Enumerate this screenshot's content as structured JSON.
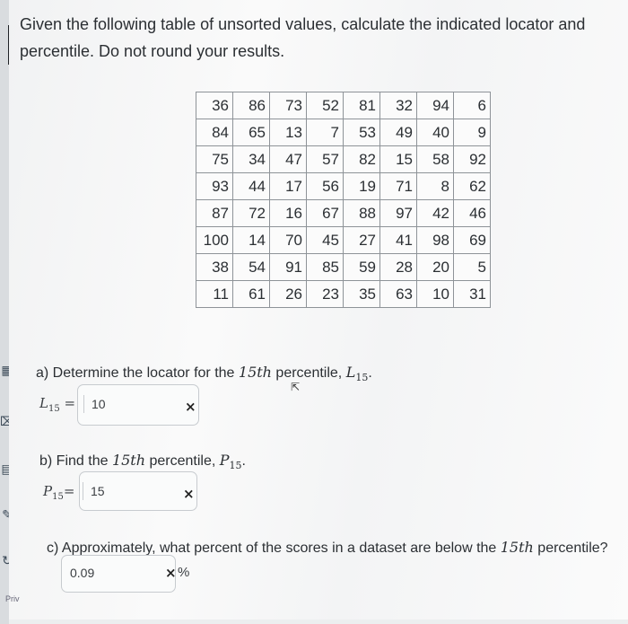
{
  "prompt": {
    "line1": "Given the following table of unsorted values, calculate the indicated locator and",
    "line2": "percentile. Do not round your results."
  },
  "table": {
    "rows": [
      [
        36,
        86,
        73,
        52,
        81,
        32,
        94,
        6
      ],
      [
        84,
        65,
        13,
        7,
        53,
        49,
        40,
        9
      ],
      [
        75,
        34,
        47,
        57,
        82,
        15,
        58,
        92
      ],
      [
        93,
        44,
        17,
        56,
        19,
        71,
        8,
        62
      ],
      [
        87,
        72,
        16,
        67,
        88,
        97,
        42,
        46
      ],
      [
        100,
        14,
        70,
        45,
        27,
        41,
        98,
        69
      ],
      [
        38,
        54,
        91,
        85,
        59,
        28,
        20,
        5
      ],
      [
        11,
        61,
        26,
        23,
        35,
        63,
        10,
        31
      ]
    ]
  },
  "questions": {
    "a": {
      "text": "a) Determine the locator for the ",
      "ordinal": "15th",
      "text2": " percentile, ",
      "symbol": "L",
      "sub": "15",
      "period": ".",
      "answer_label": "L",
      "answer_sub": "15",
      "answer_eq": " =",
      "answer_value": "10",
      "status": "×"
    },
    "b": {
      "text": "b) Find the ",
      "ordinal": "15th",
      "text2": " percentile, ",
      "symbol": "P",
      "sub": "15",
      "period": ".",
      "answer_label": "P",
      "answer_sub": "15",
      "answer_eq": "=",
      "answer_value": "15",
      "status": "×"
    },
    "c": {
      "text": "c) Approximately, what percent of the scores in a dataset are below the ",
      "ordinal": "15th",
      "text2": " percentile?",
      "answer_value": "0.09",
      "status": "×",
      "unit": "%"
    }
  },
  "footer": {
    "priv": "Priv"
  },
  "icons": [
    "grid-icon",
    "tag-icon",
    "book-icon",
    "edit-icon",
    "refresh-icon"
  ]
}
